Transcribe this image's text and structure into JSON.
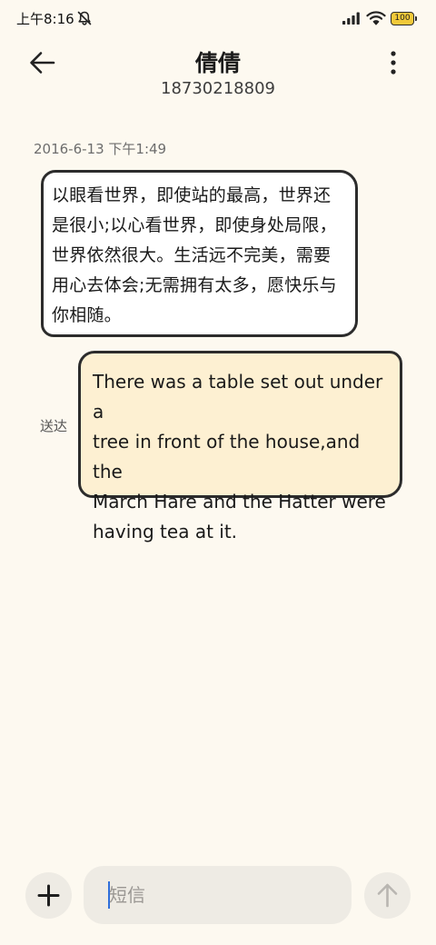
{
  "status_bar": {
    "time": "上午8:16",
    "battery_level": "100",
    "icons": [
      "mute-icon",
      "signal-icon",
      "wifi-icon",
      "battery-icon"
    ]
  },
  "header": {
    "contact_name": "倩倩",
    "phone_number": "18730218809",
    "icons": [
      "back-arrow-icon",
      "more-vertical-icon"
    ]
  },
  "conversation": {
    "timestamp": "2016-6-13 下午1:49",
    "messages": [
      {
        "direction": "incoming",
        "lines": [
          "以眼看世界，即使站的最高，世界还",
          "是很小;以心看世界，即使身处局限，",
          "世界依然很大。生活远不完美，需要",
          "用心去体会;无需拥有太多，愿快乐与",
          "你相随。"
        ]
      },
      {
        "direction": "outgoing",
        "status": "送达",
        "lines": [
          "There was a table set out under a",
          "tree in front of the house,and the",
          "March Hare and the Hatter were",
          "having tea at it."
        ]
      }
    ]
  },
  "composer": {
    "placeholder": "短信",
    "value": "",
    "icons": [
      "plus-icon",
      "send-arrow-icon"
    ]
  },
  "colors": {
    "background": "#fdf9f0",
    "incoming_bubble": "#ffffff",
    "outgoing_bubble": "#fdf0d2",
    "bubble_border": "#2c2c2c",
    "caret": "#2f6fdb",
    "battery": "#f1c93a"
  }
}
